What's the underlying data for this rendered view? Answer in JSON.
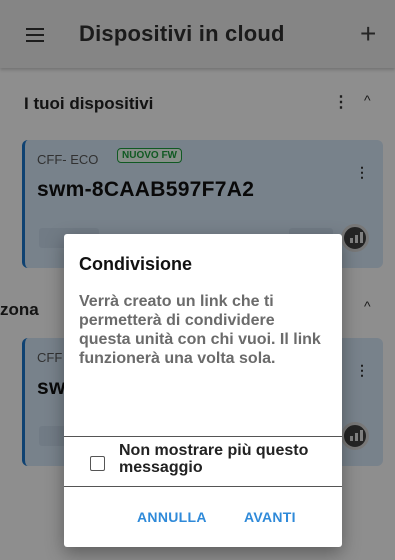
{
  "appbar": {
    "title": "Dispositivi in cloud",
    "add_symbol": "+",
    "menu_icon": "hamburger-menu-icon"
  },
  "sections": [
    {
      "label": "I tuoi dispositivi",
      "menu_symbol": "⋮",
      "collapse_symbol": "^"
    },
    {
      "label": "zona",
      "collapse_symbol": "^"
    }
  ],
  "cards": [
    {
      "model": "CFF- ECO",
      "badge": "NUOVO FW",
      "name": "swm-8CAAB597F7A2",
      "menu_symbol": "⋮"
    },
    {
      "model": "CFF",
      "name": "sw",
      "menu_symbol": "⋮"
    }
  ],
  "dialog": {
    "title": "Condivisione",
    "body": "Verrà creato un link che ti permetterà di condividere questa unità con chi vuoi. Il link funzionerà una volta sola.",
    "checkbox_label": "Non mostrare più questo messaggio",
    "checkbox_checked": false,
    "cancel_label": "ANNULLA",
    "confirm_label": "AVANTI"
  },
  "colors": {
    "accent": "#2f8ad9",
    "card_bg": "#cfe0f0",
    "card_border": "#1a73c4",
    "badge": "#1c9a3c"
  }
}
